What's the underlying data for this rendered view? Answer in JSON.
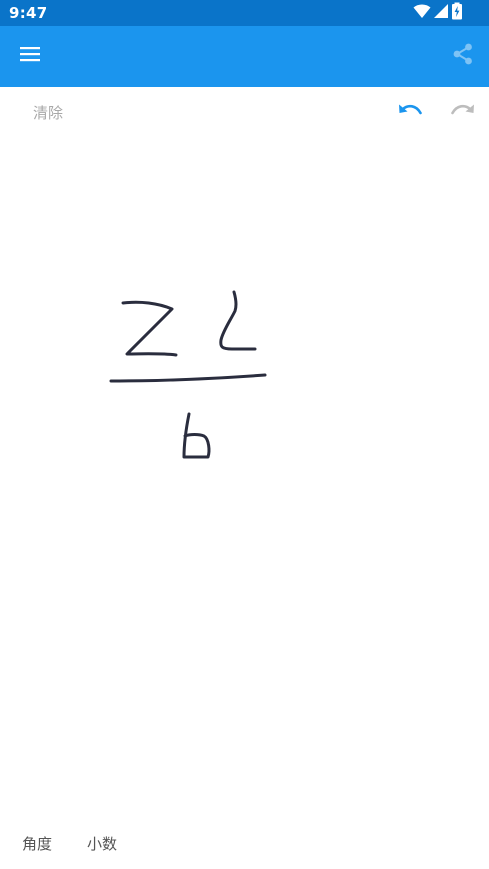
{
  "status_bar": {
    "time": "9:47",
    "icons": [
      "wifi-icon",
      "cellular-signal-icon",
      "battery-charging-icon"
    ],
    "background": "#0a74c9"
  },
  "app_bar": {
    "background": "#1b95ee",
    "menu_icon": "hamburger-menu-icon",
    "share_icon": "share-icon"
  },
  "toolbar": {
    "clear_label": "清除",
    "undo_icon": "undo-icon",
    "redo_icon": "redo-icon",
    "undo_color": "#1b95ee",
    "redo_color": "#bdbdbd"
  },
  "canvas": {
    "ink_color": "#2a2d3e"
  },
  "bottom_bar": {
    "angle_label": "角度",
    "decimal_label": "小数"
  }
}
